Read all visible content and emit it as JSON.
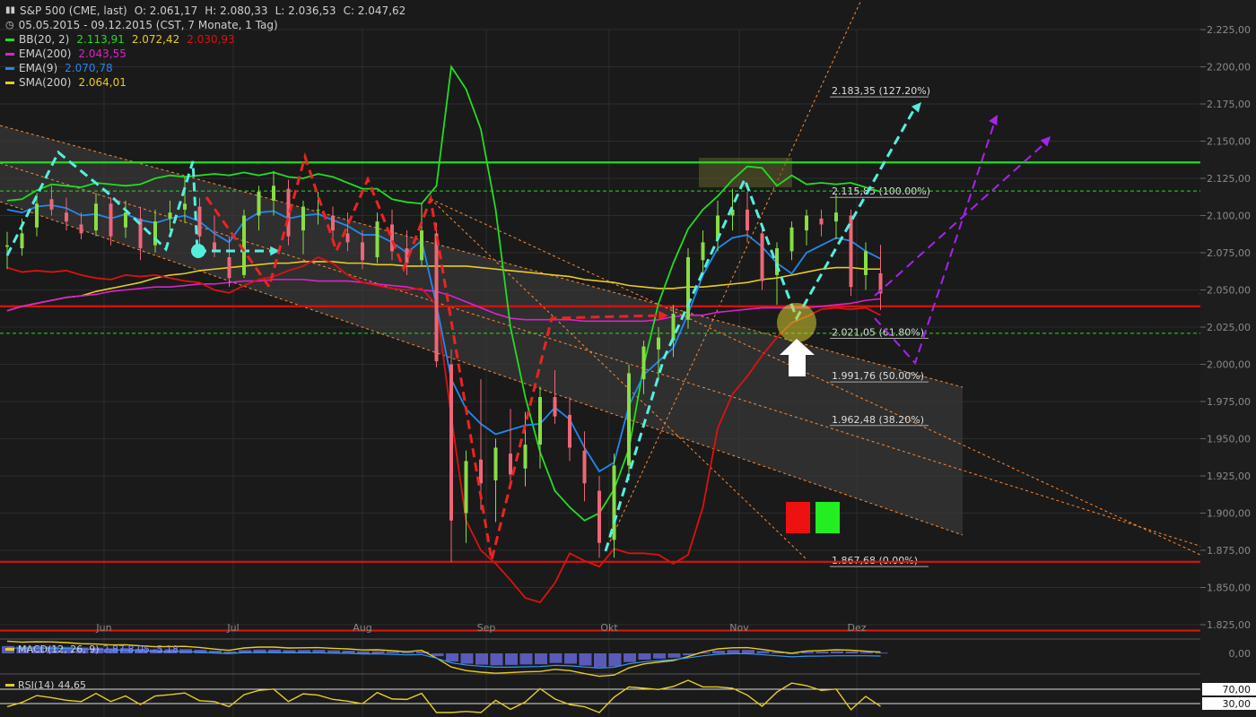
{
  "legend": {
    "title_icon": "chart-bars-icon",
    "title": "S&P 500 (CME, last)",
    "ohlc": {
      "o": "O: 2.061,17",
      "h": "H: 2.080,33",
      "l": "L: 2.036,53",
      "c": "C: 2.047,62"
    },
    "range": "05.05.2015 - 09.12.2015 (CST, 7 Monate, 1 Tag)",
    "clock_icon": "clock-icon",
    "bb": {
      "label": "BB(20, 2)",
      "v1": "2.113,91",
      "v2": "2.072,42",
      "v3": "2.030,93"
    },
    "ema200": {
      "label": "EMA(200)",
      "v": "2.043,55"
    },
    "ema9": {
      "label": "EMA(9)",
      "v": "2.070,78"
    },
    "sma200": {
      "label": "SMA(200)",
      "v": "2.064,01"
    }
  },
  "colors": {
    "bg": "#1a1a1a",
    "grid": "#2c2c2c",
    "bb_upper": "#22dd22",
    "bb_lower": "#dd1111",
    "ema200": "#dd22cc",
    "ema9": "#2288ee",
    "sma200": "#e6cc22",
    "arrow_cyan": "#55eedd",
    "arrow_red": "#ee2222",
    "arrow_purple": "#aa22ee",
    "fib": "#ff8833",
    "up": "#88dd44",
    "down": "#ee6677"
  },
  "chart_data": {
    "type": "candlestick",
    "y_range": [
      1825,
      2232
    ],
    "y_ticks": [
      "2.225,00",
      "2.200,00",
      "2.175,00",
      "2.150,00",
      "2.125,00",
      "2.100,00",
      "2.075,00",
      "2.050,00",
      "2.025,00",
      "2.000,00",
      "1.975,00",
      "1.950,00",
      "1.925,00",
      "1.900,00",
      "1.875,00",
      "1.850,00",
      "1.825,00"
    ],
    "y_tick_values": [
      2225,
      2200,
      2175,
      2150,
      2125,
      2100,
      2075,
      2050,
      2025,
      2000,
      1975,
      1950,
      1925,
      1900,
      1875,
      1850,
      1825
    ],
    "x_months": [
      "Jun",
      "Jul",
      "Aug",
      "Sep",
      "Okt",
      "Nov",
      "Dez"
    ],
    "price_tags": [
      {
        "label": "2.135,68",
        "value": 2135.68,
        "color": "#22dd22",
        "type": "level"
      },
      {
        "label": "2.116,48",
        "value": 2116.48,
        "color": "#ffffff",
        "type": "dashed"
      },
      {
        "label": "2.047,62",
        "value": 2047.62,
        "color": "#ffffff",
        "type": "tag"
      },
      {
        "label": "2.039,00",
        "value": 2039.0,
        "color": "#dd1111",
        "type": "level"
      },
      {
        "label": "2.020,86",
        "value": 2020.86,
        "color": "#22dd22",
        "type": "dashed"
      },
      {
        "label": "1.867,29",
        "value": 1867.29,
        "color": "#dd1111",
        "type": "level"
      },
      {
        "label": "1.821,05",
        "value": 1821.05,
        "color": "#dd1111",
        "type": "level"
      }
    ],
    "fib_levels": [
      {
        "label": "2.183,35 (127.20%)",
        "value": 2183.35
      },
      {
        "label": "2.115,85 (100.00%)",
        "value": 2115.85
      },
      {
        "label": "2.021,05 (61.80%)",
        "value": 2021.05
      },
      {
        "label": "1.991,76 (50.00%)",
        "value": 1991.76
      },
      {
        "label": "1.962,48 (38.20%)",
        "value": 1962.48
      },
      {
        "label": "1.867,68 (0.00%)",
        "value": 1867.68
      }
    ],
    "bb_upper": [
      2110,
      2111,
      2117,
      2121,
      2120,
      2119,
      2122,
      2121,
      2120,
      2121,
      2125,
      2127,
      2126,
      2127,
      2128,
      2127,
      2129,
      2127,
      2129,
      2126,
      2125,
      2128,
      2126,
      2122,
      2118,
      2118,
      2111,
      2109,
      2108,
      2120,
      2200,
      2185,
      2158,
      2104,
      2025,
      1978,
      1941,
      1915,
      1904,
      1895,
      1900,
      1916,
      1943,
      1999,
      2041,
      2068,
      2091,
      2104,
      2113,
      2124,
      2133,
      2132,
      2120,
      2127,
      2121,
      2122,
      2121,
      2122,
      2119,
      2116
    ],
    "bb_lower": [
      2065,
      2062,
      2063,
      2062,
      2063,
      2060,
      2058,
      2057,
      2060,
      2059,
      2060,
      2058,
      2056,
      2055,
      2050,
      2048,
      2053,
      2057,
      2059,
      2063,
      2066,
      2072,
      2068,
      2060,
      2055,
      2053,
      2051,
      2050,
      2051,
      2040,
      1965,
      1895,
      1875,
      1866,
      1855,
      1843,
      1840,
      1853,
      1873,
      1868,
      1864,
      1876,
      1873,
      1873,
      1872,
      1866,
      1872,
      1904,
      1957,
      1980,
      1992,
      2006,
      2018,
      2028,
      2032,
      2037,
      2038,
      2037,
      2038,
      2033
    ],
    "ema200": [
      2036,
      2039,
      2041,
      2043,
      2045,
      2046,
      2047,
      2049,
      2050,
      2051,
      2052,
      2052,
      2053,
      2054,
      2054,
      2055,
      2056,
      2056,
      2057,
      2057,
      2057,
      2056,
      2056,
      2056,
      2055,
      2054,
      2053,
      2052,
      2050,
      2049,
      2046,
      2042,
      2038,
      2034,
      2031,
      2030,
      2030,
      2030,
      2030,
      2029,
      2029,
      2029,
      2029,
      2029,
      2030,
      2032,
      2033,
      2033,
      2035,
      2036,
      2037,
      2038,
      2038,
      2038,
      2038,
      2039,
      2040,
      2041,
      2043,
      2044
    ],
    "sma200": [
      2036,
      2039,
      2041,
      2043,
      2045,
      2046,
      2049,
      2051,
      2053,
      2055,
      2058,
      2060,
      2061,
      2063,
      2064,
      2065,
      2066,
      2067,
      2068,
      2068,
      2069,
      2069,
      2069,
      2068,
      2068,
      2067,
      2067,
      2066,
      2066,
      2066,
      2066,
      2066,
      2065,
      2064,
      2063,
      2062,
      2061,
      2060,
      2059,
      2057,
      2056,
      2055,
      2053,
      2052,
      2051,
      2051,
      2052,
      2052,
      2053,
      2054,
      2055,
      2057,
      2058,
      2060,
      2062,
      2064,
      2065,
      2065,
      2064,
      2064
    ],
    "ema9": [
      2104,
      2102,
      2106,
      2107,
      2105,
      2100,
      2101,
      2098,
      2101,
      2097,
      2095,
      2098,
      2100,
      2096,
      2088,
      2082,
      2096,
      2102,
      2103,
      2098,
      2100,
      2101,
      2097,
      2093,
      2087,
      2087,
      2082,
      2075,
      2083,
      2040,
      1990,
      1970,
      1960,
      1953,
      1956,
      1959,
      1960,
      1971,
      1963,
      1944,
      1928,
      1934,
      1972,
      1993,
      2002,
      2011,
      2034,
      2060,
      2078,
      2085,
      2087,
      2079,
      2068,
      2061,
      2075,
      2080,
      2085,
      2083,
      2076,
      2071
    ],
    "ohlc": [
      [
        2079,
        2089,
        2064,
        2080
      ],
      [
        2078,
        2098,
        2073,
        2088
      ],
      [
        2092,
        2115,
        2086,
        2108
      ],
      [
        2111,
        2120,
        2100,
        2104
      ],
      [
        2102,
        2112,
        2090,
        2096
      ],
      [
        2094,
        2102,
        2084,
        2088
      ],
      [
        2090,
        2115,
        2086,
        2108
      ],
      [
        2108,
        2112,
        2080,
        2086
      ],
      [
        2092,
        2110,
        2085,
        2102
      ],
      [
        2098,
        2106,
        2070,
        2078
      ],
      [
        2080,
        2104,
        2075,
        2096
      ],
      [
        2098,
        2110,
        2090,
        2102
      ],
      [
        2104,
        2126,
        2095,
        2108
      ],
      [
        2106,
        2112,
        2080,
        2086
      ],
      [
        2082,
        2100,
        2072,
        2076
      ],
      [
        2072,
        2086,
        2052,
        2058
      ],
      [
        2060,
        2104,
        2058,
        2100
      ],
      [
        2100,
        2120,
        2090,
        2116
      ],
      [
        2110,
        2130,
        2100,
        2120
      ],
      [
        2118,
        2124,
        2080,
        2086
      ],
      [
        2090,
        2110,
        2074,
        2106
      ],
      [
        2104,
        2116,
        2094,
        2104
      ],
      [
        2100,
        2106,
        2082,
        2090
      ],
      [
        2088,
        2102,
        2076,
        2082
      ],
      [
        2082,
        2090,
        2064,
        2070
      ],
      [
        2072,
        2102,
        2068,
        2096
      ],
      [
        2094,
        2104,
        2070,
        2076
      ],
      [
        2078,
        2090,
        2060,
        2068
      ],
      [
        2070,
        2108,
        2066,
        2090
      ],
      [
        2088,
        2095,
        1998,
        2002
      ],
      [
        2000,
        2010,
        1867,
        1895
      ],
      [
        1900,
        1942,
        1880,
        1935
      ],
      [
        1936,
        1990,
        1902,
        1920
      ],
      [
        1922,
        1950,
        1894,
        1944
      ],
      [
        1940,
        1970,
        1921,
        1926
      ],
      [
        1930,
        1968,
        1918,
        1946
      ],
      [
        1946,
        1985,
        1930,
        1978
      ],
      [
        1978,
        1996,
        1960,
        1965
      ],
      [
        1966,
        1978,
        1935,
        1944
      ],
      [
        1942,
        1955,
        1908,
        1920
      ],
      [
        1915,
        1925,
        1870,
        1880
      ],
      [
        1882,
        1940,
        1870,
        1932
      ],
      [
        1932,
        2000,
        1922,
        1994
      ],
      [
        1990,
        2016,
        1980,
        2012
      ],
      [
        2010,
        2025,
        1990,
        2018
      ],
      [
        2016,
        2040,
        2005,
        2034
      ],
      [
        2030,
        2078,
        2024,
        2072
      ],
      [
        2070,
        2090,
        2062,
        2082
      ],
      [
        2084,
        2110,
        2076,
        2100
      ],
      [
        2100,
        2118,
        2090,
        2104
      ],
      [
        2104,
        2116,
        2082,
        2090
      ],
      [
        2088,
        2094,
        2050,
        2056
      ],
      [
        2060,
        2082,
        2040,
        2078
      ],
      [
        2076,
        2096,
        2070,
        2092
      ],
      [
        2090,
        2104,
        2080,
        2100
      ],
      [
        2098,
        2104,
        2086,
        2094
      ],
      [
        2096,
        2114,
        2084,
        2102
      ],
      [
        2100,
        2104,
        2046,
        2052
      ],
      [
        2060,
        2082,
        2050,
        2076
      ],
      [
        2061.17,
        2080.33,
        2036.53,
        2047.62
      ]
    ],
    "macd": {
      "label": "MACD(12, 26, 9)",
      "values": "2,87  8,05  -5,18",
      "tick": "0,00"
    },
    "rsi": {
      "label": "RSI(14)",
      "value": "44,65",
      "ticks": [
        "70,00",
        "30,00"
      ]
    }
  }
}
